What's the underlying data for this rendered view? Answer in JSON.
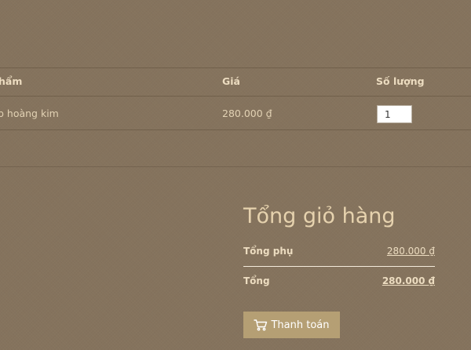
{
  "cart": {
    "headers": {
      "product": "hẩm",
      "price": "Giá",
      "quantity": "Số lượng"
    },
    "items": [
      {
        "name": "p hoàng kim",
        "price": "280.000 ₫",
        "quantity": "1"
      }
    ]
  },
  "totals": {
    "title": "Tổng giỏ hàng",
    "subtotal_label": "Tổng phụ",
    "subtotal_value": "280.000 ₫",
    "total_label": "Tổng",
    "total_value": "280.000 ₫"
  },
  "checkout": {
    "label": "Thanh toán",
    "icon": "cart-icon"
  },
  "colors": {
    "background": "#85735d",
    "accent_button": "#b59f74",
    "title_text": "#e6d2ae"
  }
}
